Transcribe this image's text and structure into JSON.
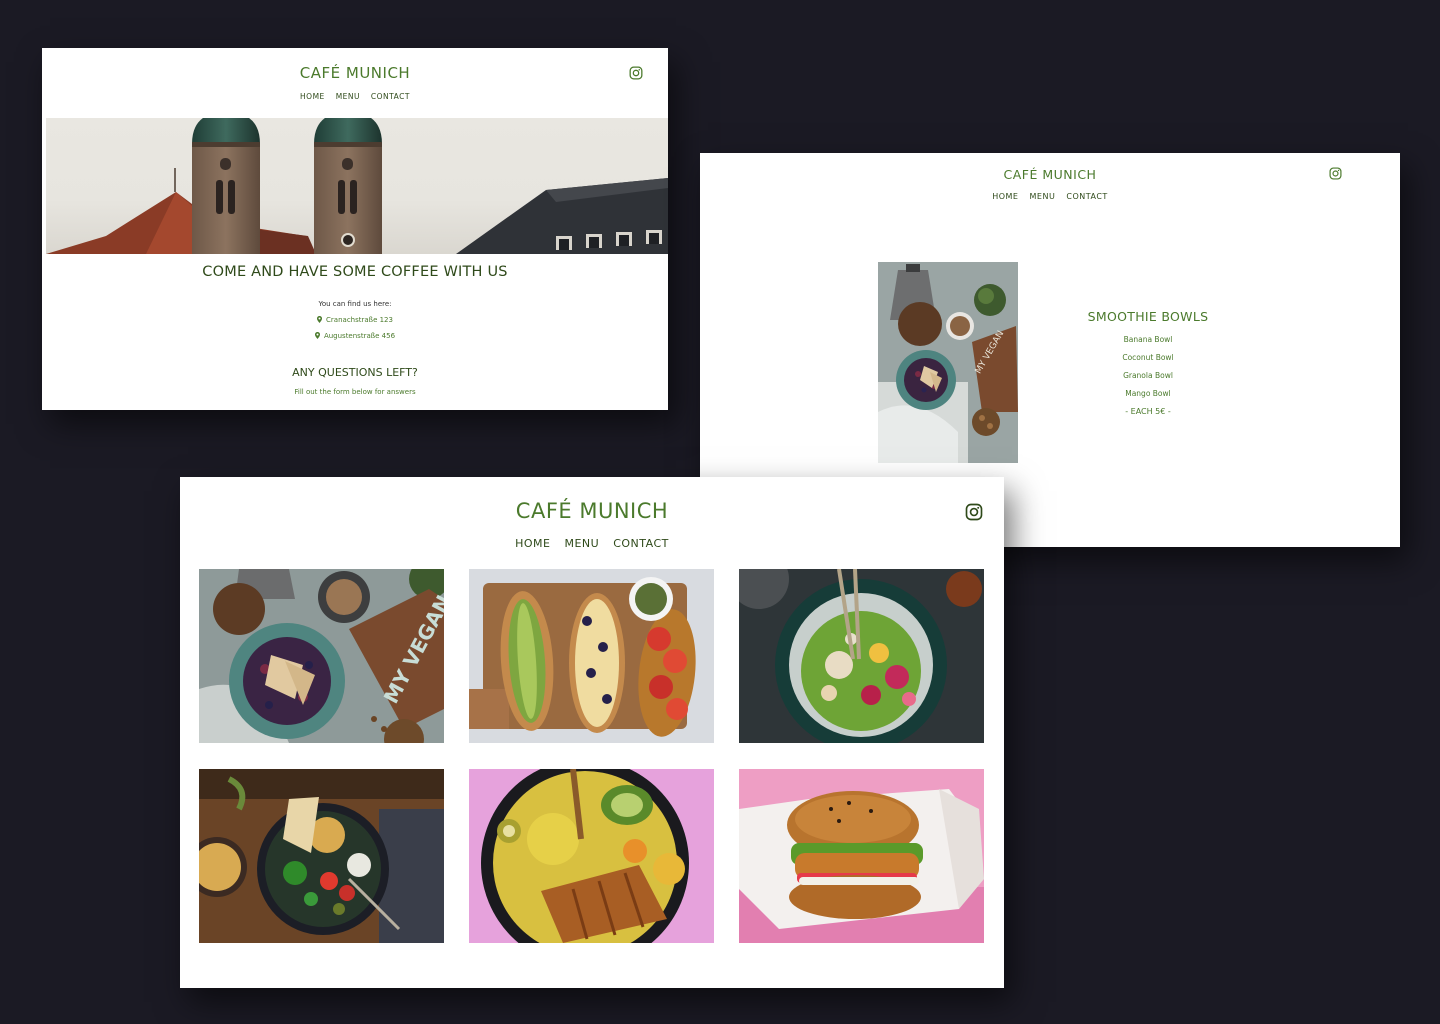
{
  "site": {
    "brand": "CAFÉ MUNICH",
    "nav": [
      "HOME",
      "MENU",
      "CONTACT"
    ]
  },
  "home": {
    "heading": "COME AND HAVE SOME COFFEE WITH US",
    "find_label": "You can find us here:",
    "addresses": [
      "Cranachstraße 123",
      "Augustenstraße 456"
    ],
    "questions_heading": "ANY QUESTIONS LEFT?",
    "form_hint": "Fill out the form below for answers"
  },
  "menu": {
    "section_title": "SMOOTHIE BOWLS",
    "items": [
      "Banana Bowl",
      "Coconut Bowl",
      "Granola Bowl",
      "Mango Bowl"
    ],
    "price_note": "- EACH 5€ -"
  },
  "icons": {
    "social": "instagram-icon",
    "location": "location-pin-icon"
  },
  "colors": {
    "background": "#1b1a24",
    "brand_green": "#4b7a2c",
    "dark_green": "#2f4a1a"
  }
}
